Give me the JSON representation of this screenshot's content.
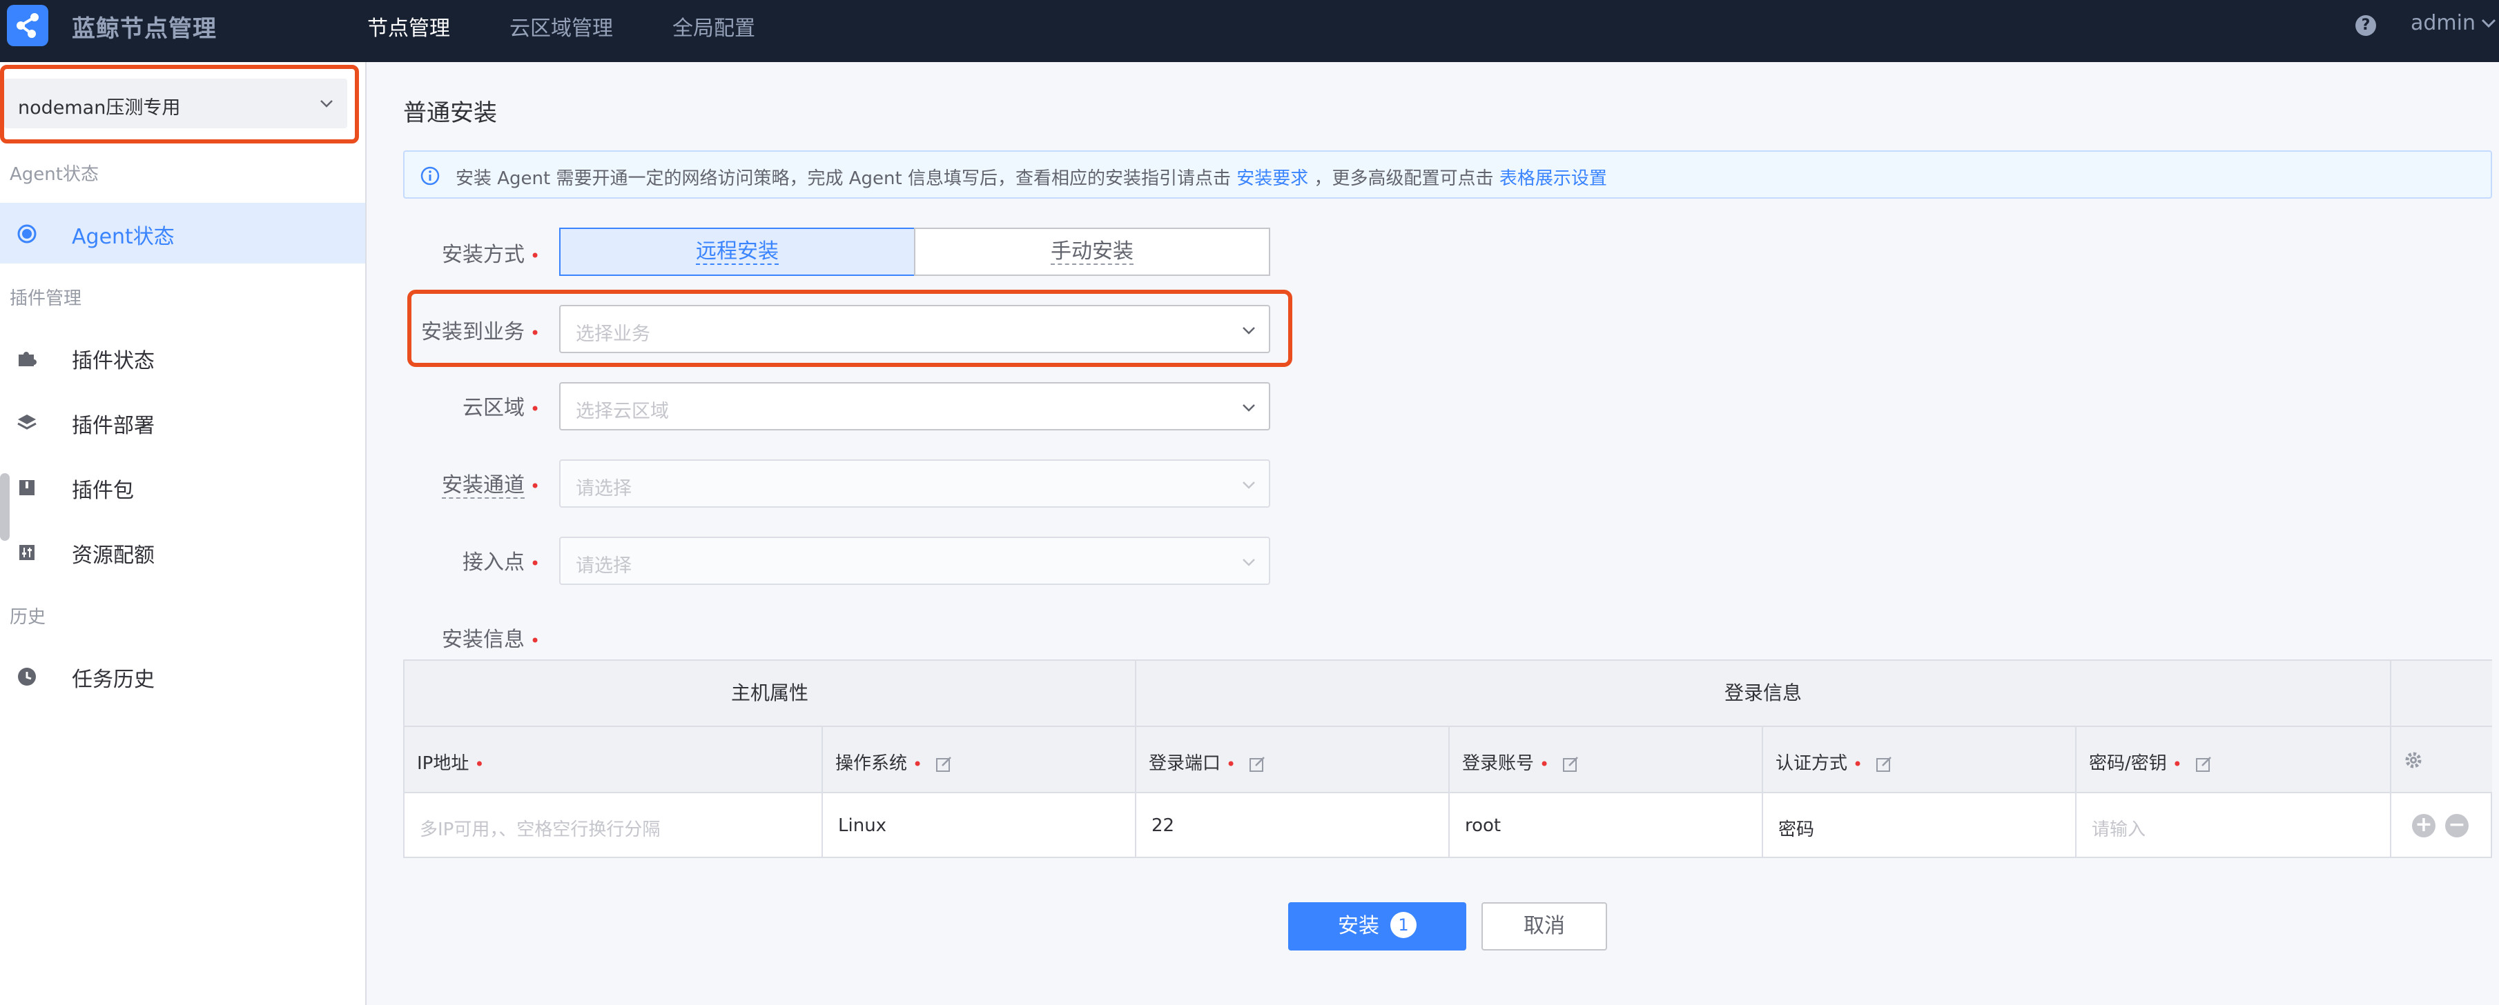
{
  "app": {
    "title": "蓝鲸节点管理"
  },
  "nav": {
    "items": [
      "节点管理",
      "云区域管理",
      "全局配置"
    ],
    "active_index": 0
  },
  "user": {
    "name": "admin",
    "help_icon": "help-icon"
  },
  "sidebar": {
    "business_select": {
      "value": "nodeman压测专用"
    },
    "groups": [
      {
        "label": "Agent状态",
        "items": [
          {
            "label": "Agent状态",
            "icon": "radio-dot-icon",
            "active": true
          }
        ]
      },
      {
        "label": "插件管理",
        "items": [
          {
            "label": "插件状态",
            "icon": "puzzle-icon"
          },
          {
            "label": "插件部署",
            "icon": "layers-icon"
          },
          {
            "label": "插件包",
            "icon": "package-icon"
          },
          {
            "label": "资源配额",
            "icon": "sliders-icon"
          }
        ]
      },
      {
        "label": "历史",
        "items": [
          {
            "label": "任务历史",
            "icon": "clock-icon"
          }
        ]
      }
    ]
  },
  "page": {
    "title": "普通安装"
  },
  "alert": {
    "text_1": "安装 Agent 需要开通一定的网络访问策略，完成 Agent 信息填写后，查看相应的安装指引请点击",
    "link_1": "安装要求",
    "text_2": "，更多高级配置可点击",
    "link_2": "表格展示设置"
  },
  "form": {
    "install_mode": {
      "label": "安装方式",
      "options": [
        "远程安装",
        "手动安装"
      ],
      "selected": "远程安装"
    },
    "business": {
      "label": "安装到业务",
      "placeholder": "选择业务"
    },
    "cloud_area": {
      "label": "云区域",
      "placeholder": "选择云区域"
    },
    "channel": {
      "label": "安装通道",
      "placeholder": "请选择"
    },
    "access_point": {
      "label": "接入点",
      "placeholder": "请选择"
    },
    "install_info": {
      "label": "安装信息"
    }
  },
  "table": {
    "groups": [
      "主机属性",
      "登录信息"
    ],
    "columns": [
      {
        "label": "IP地址",
        "required": true,
        "editable": false
      },
      {
        "label": "操作系统",
        "required": true,
        "editable": true
      },
      {
        "label": "登录端口",
        "required": true,
        "editable": true
      },
      {
        "label": "登录账号",
        "required": true,
        "editable": true
      },
      {
        "label": "认证方式",
        "required": true,
        "editable": true
      },
      {
        "label": "密码/密钥",
        "required": true,
        "editable": true
      }
    ],
    "row": {
      "ip_placeholder": "多IP可用，、空格空行换行分隔",
      "os": "Linux",
      "port": "22",
      "account": "root",
      "auth": "密码",
      "password_placeholder": "请输入"
    }
  },
  "actions": {
    "install_label": "安装",
    "install_count": "1",
    "cancel_label": "取消"
  },
  "colors": {
    "accent": "#3a84ff",
    "highlight": "#ea4e1e",
    "topbar": "#182132"
  }
}
